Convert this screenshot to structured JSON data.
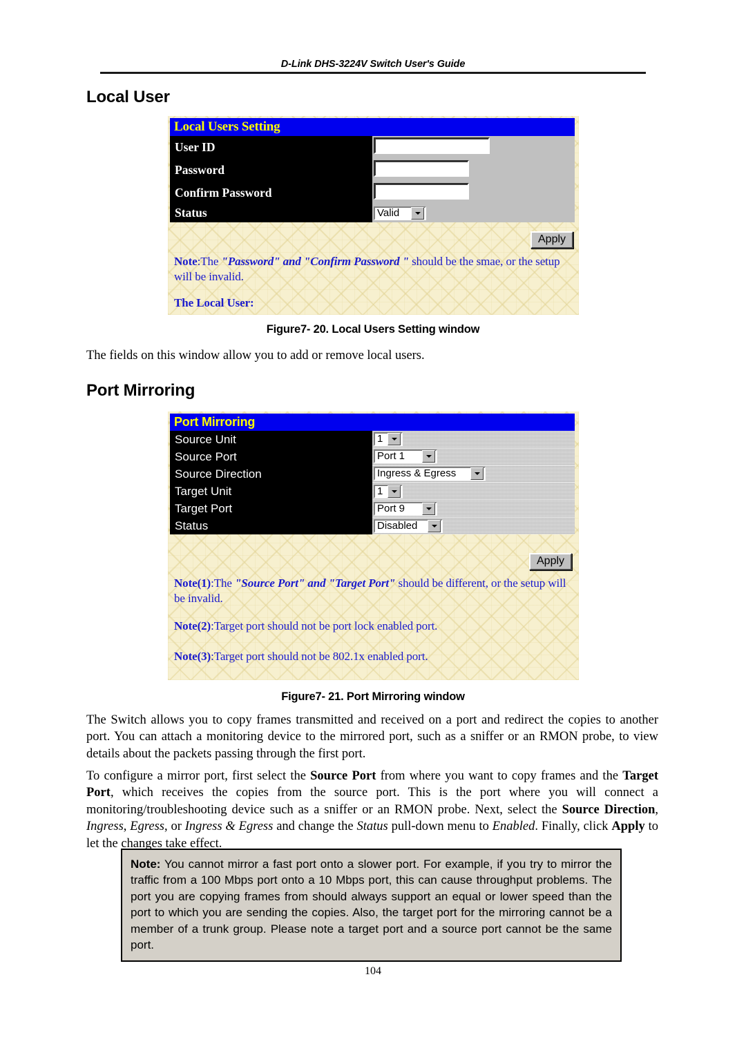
{
  "header": {
    "running_title": "D-Link DHS-3224V Switch User's Guide"
  },
  "sections": {
    "local_user": {
      "heading": "Local User",
      "figure": {
        "title_bar": "Local Users Setting",
        "rows": [
          {
            "label": "User ID",
            "widget": "text-input",
            "value": ""
          },
          {
            "label": "Password",
            "widget": "text-input",
            "value": ""
          },
          {
            "label": "Confirm Password",
            "widget": "text-input",
            "value": ""
          },
          {
            "label": "Status",
            "widget": "select",
            "value": "Valid"
          }
        ],
        "apply_label": "Apply",
        "note_label": "Note",
        "note_sep": ":The ",
        "note_em1": "\"Password\" and \"Confirm Password \"",
        "note_tail": " should be the smae, or the setup will be invalid.",
        "sub_heading": "The Local User:"
      },
      "caption": "Figure7- 20.  Local Users Setting window",
      "paragraph": "The fields on this window allow you to add or remove local users."
    },
    "port_mirroring": {
      "heading": "Port Mirroring",
      "figure": {
        "title_bar": "Port Mirroring",
        "rows": [
          {
            "label": "Source Unit",
            "widget": "select",
            "value": "1"
          },
          {
            "label": "Source Port",
            "widget": "select",
            "value": "Port 1"
          },
          {
            "label": "Source Direction",
            "widget": "select",
            "value": "Ingress & Egress"
          },
          {
            "label": "Target Unit",
            "widget": "select",
            "value": "1"
          },
          {
            "label": "Target Port",
            "widget": "select",
            "value": "Port 9"
          },
          {
            "label": "Status",
            "widget": "select",
            "value": "Disabled"
          }
        ],
        "apply_label": "Apply",
        "note1_label": "Note(1)",
        "note1_sep": ":The ",
        "note1_em": "\"Source Port\" and \"Target Port\"",
        "note1_tail": " should be different, or the setup will be invalid.",
        "note2_label": "Note(2)",
        "note2_text": ":Target port should not be port lock enabled port.",
        "note3_label": "Note(3)",
        "note3_text": ":Target port should not be 802.1x enabled port."
      },
      "caption": "Figure7- 21.  Port Mirroring window",
      "paragraph_1": "The Switch allows you to copy frames transmitted and received on a port and redirect the copies to another port. You can attach a monitoring device to the mirrored port, such as a sniffer or an RMON probe, to view details about the packets passing through the first port.",
      "paragraph_2": {
        "t1": "To configure a mirror port, first select the ",
        "b1": "Source Port",
        "t2": " from where you want to copy frames and the ",
        "b2": "Target Port",
        "t3": ", which receives the copies from the source port. This is the port where you will connect a monitoring/troubleshooting device such as a sniffer or an RMON probe. Next, select the ",
        "b3": "Source Direction",
        "t4": ", ",
        "i1": "Ingress",
        "t5": ", ",
        "i2": "Egress",
        "t6": ", or ",
        "i3": "Ingress & Egress",
        "t7": " and change the ",
        "i4": "Status",
        "t8": " pull-down menu to ",
        "i5": "Enabled",
        "t9": ". Finally, click ",
        "b4": "Apply",
        "t10": " to let the changes take effect."
      }
    }
  },
  "note_box": {
    "label": "Note:",
    "text": "  You cannot mirror a fast port onto a slower port. For example, if you try to mirror the traffic from a 100 Mbps port onto a 10 Mbps port, this can cause throughput problems. The port you are copying frames from should always support an equal or lower speed than the port to which you are sending the copies. Also, the target port for the mirroring cannot be a member of a trunk group. Please note a target port and a source port cannot be the same port."
  },
  "footer": {
    "page_number": "104"
  },
  "colors": {
    "title_bar_bg": "#0000ee",
    "title_bar_fg": "#ffff00",
    "row_label_bg": "#000000",
    "row_label_fg": "#ffffff",
    "field_bg": "#c0c0c0",
    "panel_bg": "#f7f0cf",
    "note_text": "#1a1acc",
    "note_box_bg": "#d4d0c8"
  }
}
